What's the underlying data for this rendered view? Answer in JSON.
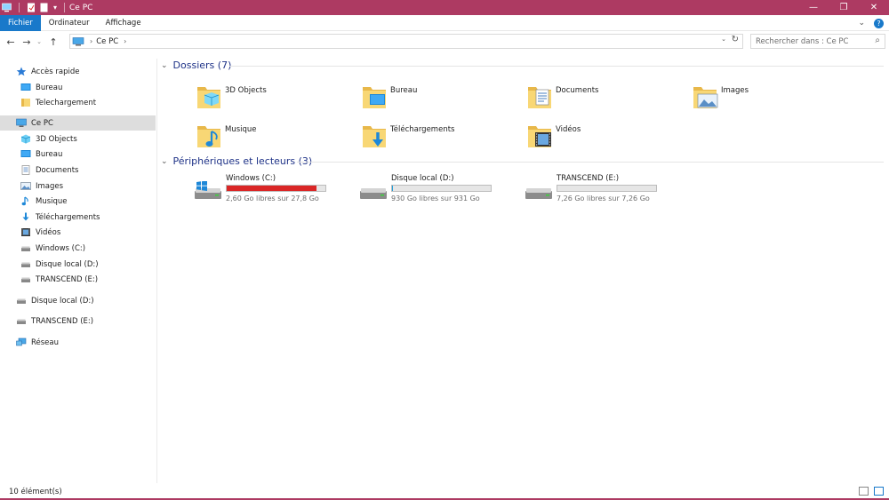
{
  "window": {
    "title": "Ce PC",
    "accent": "#ad3a62",
    "controls": {
      "minimize": "—",
      "maximize": "❐",
      "close": "✕"
    }
  },
  "ribbon": {
    "tabs": [
      {
        "label": "Fichier",
        "active": true
      },
      {
        "label": "Ordinateur",
        "active": false
      },
      {
        "label": "Affichage",
        "active": false
      }
    ],
    "expand_icon": "⌄",
    "help_icon": "?"
  },
  "address": {
    "path": "Ce PC",
    "separator": "›",
    "search_placeholder": "Rechercher dans : Ce PC"
  },
  "nav_pane": {
    "items": [
      {
        "label": "Accès rapide",
        "icon": "star-icon"
      },
      {
        "label": "Bureau",
        "icon": "desktop-icon"
      },
      {
        "label": "Telechargement",
        "icon": "folder-icon"
      },
      {
        "label": "Ce PC",
        "icon": "computer-icon",
        "selected": true
      },
      {
        "label": "3D Objects",
        "icon": "3d-objects-icon"
      },
      {
        "label": "Bureau",
        "icon": "desktop-icon"
      },
      {
        "label": "Documents",
        "icon": "documents-icon"
      },
      {
        "label": "Images",
        "icon": "images-icon"
      },
      {
        "label": "Musique",
        "icon": "music-icon"
      },
      {
        "label": "Téléchargements",
        "icon": "downloads-icon"
      },
      {
        "label": "Vidéos",
        "icon": "videos-icon"
      },
      {
        "label": "Windows (C:)",
        "icon": "drive-icon"
      },
      {
        "label": "Disque local (D:)",
        "icon": "drive-icon"
      },
      {
        "label": "TRANSCEND (E:)",
        "icon": "drive-icon"
      },
      {
        "label": "Disque local (D:)",
        "icon": "drive-icon"
      },
      {
        "label": "TRANSCEND (E:)",
        "icon": "drive-icon"
      },
      {
        "label": "Réseau",
        "icon": "network-icon"
      }
    ]
  },
  "content": {
    "folders_header": "Dossiers (7)",
    "folders": [
      {
        "label": "3D Objects",
        "icon": "3d-objects-folder-icon"
      },
      {
        "label": "Bureau",
        "icon": "desktop-folder-icon"
      },
      {
        "label": "Documents",
        "icon": "documents-folder-icon"
      },
      {
        "label": "Images",
        "icon": "images-folder-icon"
      },
      {
        "label": "Musique",
        "icon": "music-folder-icon"
      },
      {
        "label": "Téléchargements",
        "icon": "downloads-folder-icon"
      },
      {
        "label": "Vidéos",
        "icon": "videos-folder-icon"
      }
    ],
    "drives_header": "Périphériques et lecteurs (3)",
    "drives": [
      {
        "name": "Windows (C:)",
        "free": "2,60 Go libres sur 27,8 Go",
        "used_fraction": 0.906,
        "bar_color": "#da2626",
        "icon": "windows-drive-icon"
      },
      {
        "name": "Disque local (D:)",
        "free": "930 Go libres sur 931 Go",
        "used_fraction": 0.001,
        "bar_color": "#26a0da",
        "icon": "hard-drive-icon"
      },
      {
        "name": "TRANSCEND (E:)",
        "free": "7,26 Go libres sur 7,26 Go",
        "used_fraction": 0.0,
        "bar_color": "#26a0da",
        "icon": "hard-drive-icon"
      }
    ]
  },
  "status": {
    "count": "10 élément(s)"
  }
}
